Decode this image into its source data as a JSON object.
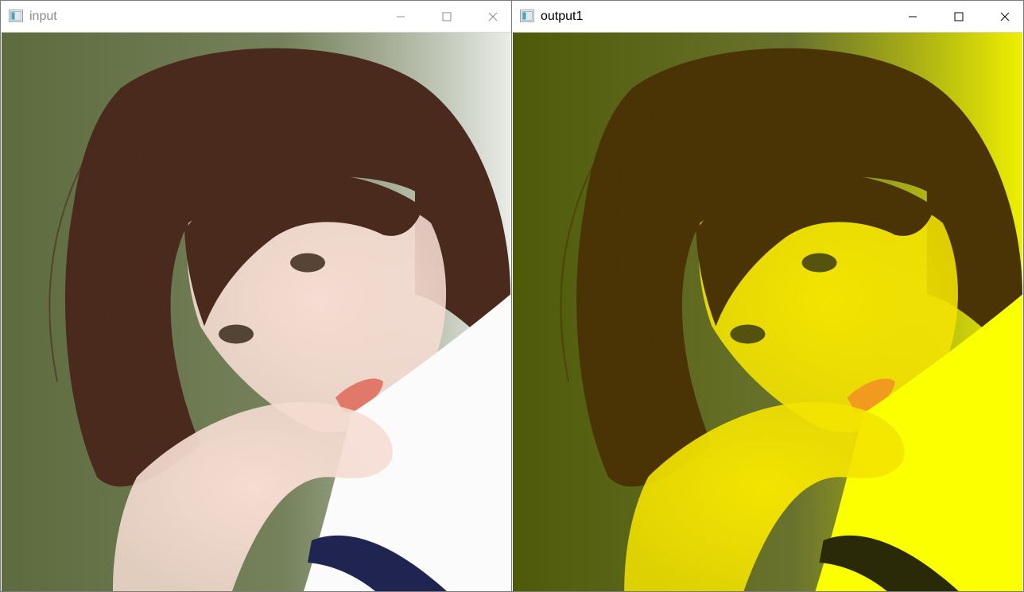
{
  "windows": [
    {
      "title": "input",
      "active": false,
      "controls": [
        "minimize-icon",
        "maximize-icon",
        "close-icon"
      ],
      "image": {
        "description_tint": "original",
        "palette": {
          "bg_left": "#5d6b3e",
          "bg_right": "#e9ece8",
          "hair": "#4a2a1c",
          "skin": "#f6dcd2",
          "shirt": "#fbfbfb",
          "collar": "#1f2550",
          "lips": "#e0796a"
        }
      }
    },
    {
      "title": "output1",
      "active": true,
      "controls": [
        "minimize-icon",
        "maximize-icon",
        "close-icon"
      ],
      "image": {
        "description_tint": "yellow",
        "palette": {
          "bg_left": "#4f5a08",
          "bg_right": "#eef000",
          "hair": "#4a3406",
          "skin": "#f4e400",
          "shirt": "#fbff00",
          "collar": "#2a2a08",
          "lips": "#f09a20"
        }
      }
    }
  ]
}
